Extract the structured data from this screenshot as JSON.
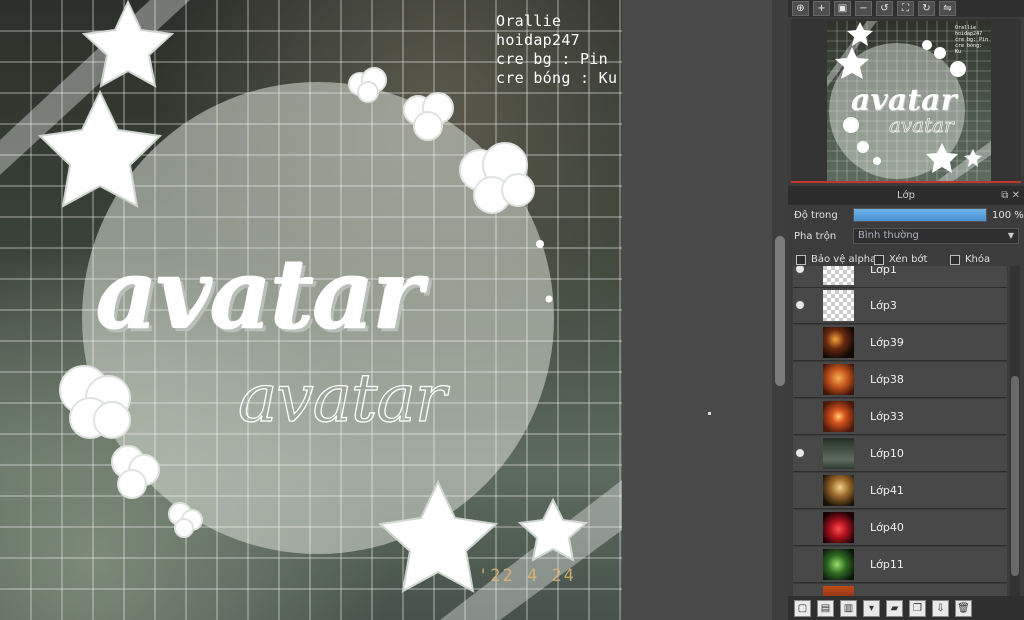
{
  "canvas": {
    "credits": [
      "Orallie",
      "hoidap247",
      "cre bg : Pin",
      "cre bóng : Ku"
    ],
    "title_main": "avatar",
    "title_ghost": "avatar",
    "date_stamp": "'22 4 24"
  },
  "navigator": {
    "toolbar_icons": [
      "zoom-fit-icon",
      "zoom-in-icon",
      "fit-window-icon",
      "zoom-out-icon",
      "rotate-left-icon",
      "fullscreen-icon",
      "rotate-right-icon",
      "flip-icon"
    ],
    "thumb_credits": [
      "Orallie",
      "hoidap247",
      "cre bg: Pin",
      "cre bóng: Ku"
    ],
    "thumb_title": "avatar"
  },
  "layers_panel": {
    "title": "Lớp",
    "opacity_label": "Độ trong",
    "opacity_value": "100 %",
    "opacity_fraction": 1.0,
    "blend_label": "Pha trộn",
    "blend_value": "Bình thường",
    "checkbox_protect_alpha": "Bảo vệ alpha",
    "checkbox_clip": "Xén bớt",
    "checkbox_lock": "Khóa",
    "layers": [
      {
        "name": "Lớp1",
        "visible": true,
        "thumb": "transparent"
      },
      {
        "name": "Lớp3",
        "visible": true,
        "thumb": "transparent"
      },
      {
        "name": "Lớp39",
        "visible": false,
        "thumb": "dark-orange"
      },
      {
        "name": "Lớp38",
        "visible": false,
        "thumb": "orange-warm"
      },
      {
        "name": "Lớp33",
        "visible": false,
        "thumb": "fire-red"
      },
      {
        "name": "Lớp10",
        "visible": true,
        "thumb": "night-green"
      },
      {
        "name": "Lớp41",
        "visible": false,
        "thumb": "portrait-yellow"
      },
      {
        "name": "Lớp40",
        "visible": false,
        "thumb": "red-glow"
      },
      {
        "name": "Lớp11",
        "visible": false,
        "thumb": "green-lights"
      }
    ],
    "bottom_toolbar_icons": [
      "new-layer-icon",
      "new-raster-icon",
      "new-vector-icon",
      "new-folder-menu-icon",
      "folder-icon",
      "duplicate-icon",
      "merge-icon",
      "trash-icon"
    ]
  },
  "colors": {
    "accent_blue": "#5aa6e3",
    "panel_bg": "#3c3c3c",
    "navigator_border": "#c0392b"
  }
}
